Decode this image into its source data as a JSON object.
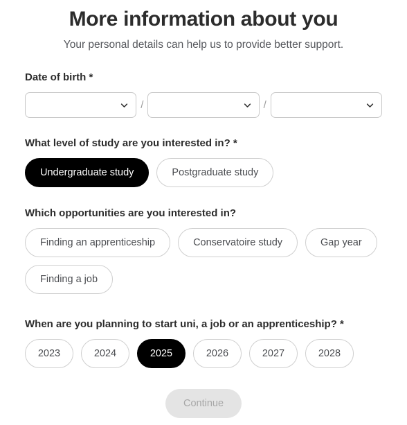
{
  "header": {
    "title": "More information about you",
    "subtitle": "Your personal details can help us to provide better support."
  },
  "date_of_birth": {
    "label": "Date of birth *",
    "separator": "/",
    "day": {
      "value": "",
      "placeholder": ""
    },
    "month": {
      "value": "",
      "placeholder": ""
    },
    "year": {
      "value": "",
      "placeholder": ""
    },
    "chevron_icon": "chevron-down-icon"
  },
  "level_of_study": {
    "label": "What level of study are you interested in? *",
    "options": [
      {
        "label": "Undergraduate study",
        "selected": true
      },
      {
        "label": "Postgraduate study",
        "selected": false
      }
    ]
  },
  "opportunities": {
    "label": "Which opportunities are you interested in?",
    "options": [
      {
        "label": "Finding an apprenticeship",
        "selected": false
      },
      {
        "label": "Conservatoire study",
        "selected": false
      },
      {
        "label": "Gap year",
        "selected": false
      },
      {
        "label": "Finding a job",
        "selected": false
      }
    ]
  },
  "start_year": {
    "label": "When are you planning to start uni, a job or an apprenticeship? *",
    "options": [
      {
        "label": "2023",
        "selected": false
      },
      {
        "label": "2024",
        "selected": false
      },
      {
        "label": "2025",
        "selected": true
      },
      {
        "label": "2026",
        "selected": false
      },
      {
        "label": "2027",
        "selected": false
      },
      {
        "label": "2028",
        "selected": false
      }
    ]
  },
  "footer": {
    "continue_label": "Continue",
    "continue_disabled": true
  },
  "colors": {
    "selected_pill_bg": "#000000",
    "selected_pill_text": "#ffffff",
    "pill_border": "#cfcfcf",
    "text_primary": "#2c2c2c",
    "text_secondary": "#54565b",
    "disabled_button_bg": "#e4e4e4",
    "disabled_button_text": "#a6a6a6"
  }
}
